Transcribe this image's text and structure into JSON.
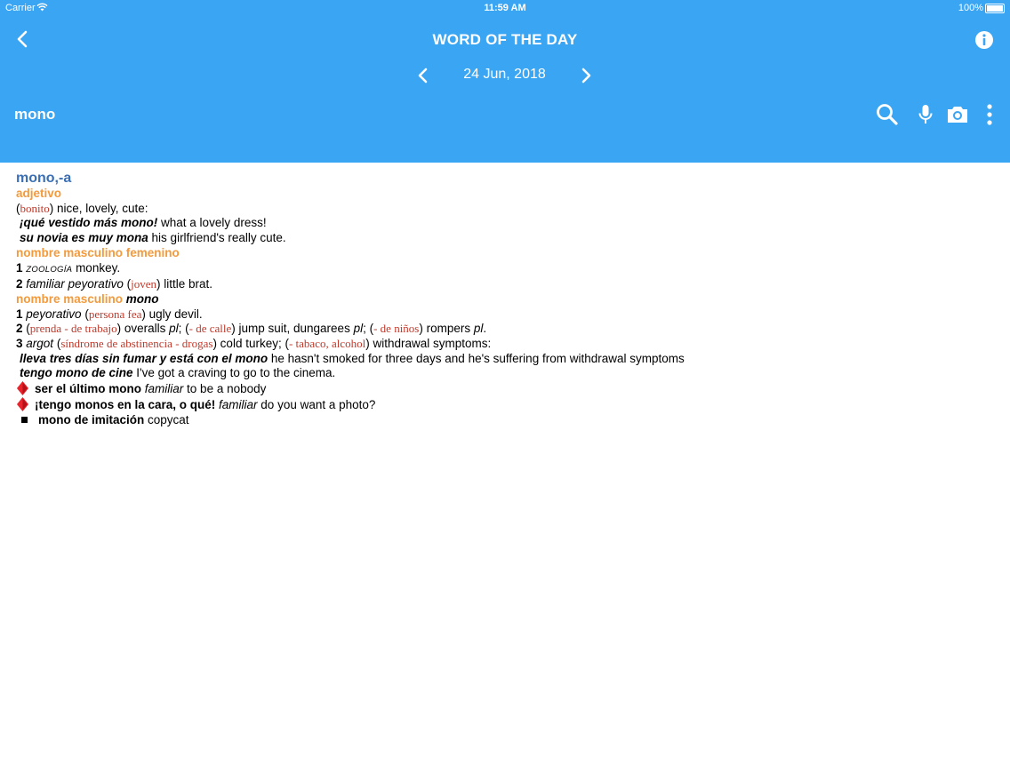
{
  "status_bar": {
    "carrier": "Carrier",
    "time": "11:59 AM",
    "battery": "100%"
  },
  "header": {
    "title": "WORD OF THE DAY",
    "date": "24 Jun, 2018",
    "search_word": "mono",
    "color": "#3aa5f3"
  },
  "entry": {
    "headword": "mono,-a",
    "pos_adj": "adjetivo",
    "adj_gloss_open": "(",
    "adj_gloss": "bonito",
    "adj_gloss_close": ") nice, lovely, cute:",
    "ex1_es": "¡qué vestido más mono!",
    "ex1_en": " what a lovely dress!",
    "ex2_es": "su novia es muy mona",
    "ex2_en": " his girlfriend's really cute.",
    "pos_noun_mf": "nombre masculino femenino",
    "mf1_num": "1",
    "mf1_field": "ZOOLOGÍA",
    "mf1_text": " monkey.",
    "mf2_num": "2",
    "mf2_reg": "familiar peyorativo",
    "mf2_open": " (",
    "mf2_gloss": "joven",
    "mf2_close": ") little brat.",
    "pos_noun_m": "nombre masculino",
    "pos_noun_m_word": "mono",
    "m1_num": "1",
    "m1_reg": "peyorativo",
    "m1_open": " (",
    "m1_gloss": "persona fea",
    "m1_close": ") ugly devil.",
    "m2_num": "2",
    "m2_open": " (",
    "m2_gloss1": "prenda - de trabajo",
    "m2_mid1": ") overalls ",
    "m2_pl1": "pl",
    "m2_mid2": "; (",
    "m2_gloss2": "- de calle",
    "m2_mid3": ") jump suit, dungarees ",
    "m2_pl2": "pl",
    "m2_mid4": "; (",
    "m2_gloss3": "- de niños",
    "m2_mid5": ") rompers ",
    "m2_pl3": "pl",
    "m2_end": ".",
    "m3_num": "3",
    "m3_reg": "argot",
    "m3_open": " (",
    "m3_gloss1": "síndrome de abstinencia - drogas",
    "m3_mid1": ") cold turkey; (",
    "m3_gloss2": "- tabaco, alcohol",
    "m3_end": ") withdrawal symptoms:",
    "ex3_es": "lleva tres días sin fumar y está con el mono",
    "ex3_en": " he hasn't smoked for three days and he's suffering from withdrawal symptoms",
    "ex4_es": "tengo mono de cine",
    "ex4_en": " I've got a craving to go to the cinema.",
    "idiom1": "ser el último mono",
    "idiom1_reg": " familiar",
    "idiom1_en": " to be a nobody",
    "idiom2": "¡tengo monos en la cara, o qué!",
    "idiom2_reg": " familiar",
    "idiom2_en": " do you want a photo?",
    "compound": "mono de imitación",
    "compound_en": " copycat",
    "colors": {
      "headword": "#3b6fb4",
      "pos": "#f39a3c",
      "gloss": "#c0392b"
    }
  }
}
